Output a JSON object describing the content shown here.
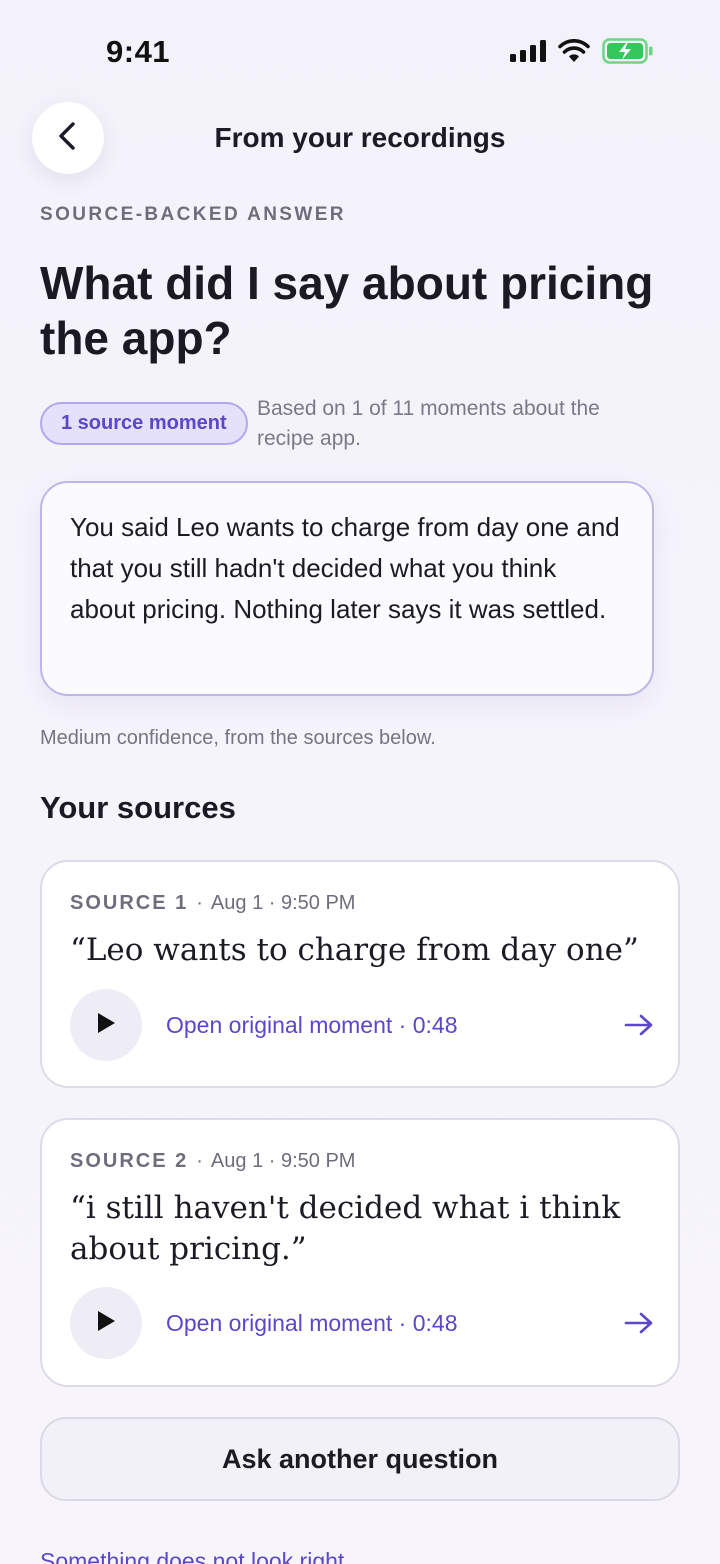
{
  "status_bar": {
    "time": "9:41"
  },
  "header": {
    "title": "From your recordings"
  },
  "eyebrow": "SOURCE-BACKED ANSWER",
  "question": "What did I say about pricing the app?",
  "source_pill": "1 source moment",
  "meta_text": "Based on 1 of 11 moments about the recipe app.",
  "answer": "You said Leo wants to charge from day one and that you still hadn't decided what you think about pricing. Nothing later says it was settled.",
  "confidence": "Medium confidence, from the sources below.",
  "sources_heading": "Your sources",
  "sources": [
    {
      "label": "SOURCE 1",
      "separator": "·",
      "timestamp": "Aug 1 · 9:50 PM",
      "quote": "“Leo wants to charge from day one”",
      "action": "Open original moment · 0:48"
    },
    {
      "label": "SOURCE 2",
      "separator": "·",
      "timestamp": "Aug 1 · 9:50 PM",
      "quote": "“i still haven't decided what i think about pricing.”",
      "action": "Open original moment · 0:48"
    }
  ],
  "ask_button": "Ask another question",
  "feedback_link": "Something does not look right",
  "colors": {
    "accent": "#5a47c9",
    "pill_bg": "#e6e1fb",
    "battery_green": "#34c759"
  },
  "icons": {
    "back": "chevron-left-icon",
    "play": "play-icon",
    "arrow": "arrow-right-icon"
  }
}
